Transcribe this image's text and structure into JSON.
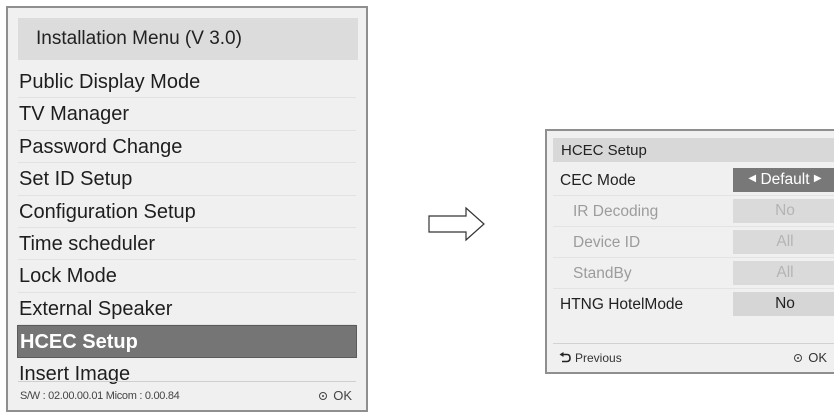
{
  "install_menu": {
    "title": "Installation Menu (V 3.0)",
    "items": [
      {
        "label": "Public Display Mode"
      },
      {
        "label": "TV Manager"
      },
      {
        "label": "Password Change"
      },
      {
        "label": "Set ID Setup"
      },
      {
        "label": "Configuration Setup"
      },
      {
        "label": "Time scheduler"
      },
      {
        "label": "Lock Mode"
      },
      {
        "label": "External Speaker"
      },
      {
        "label": "HCEC Setup",
        "selected": true
      },
      {
        "label": "Insert Image"
      }
    ],
    "footer": {
      "firmware": "S/W : 02.00.00.01  Micom : 0.00.84",
      "ok_label": "OK",
      "ok_icon": "ok-button-icon"
    }
  },
  "arrow": {
    "icon": "right-arrow-icon"
  },
  "hcec_setup": {
    "title": "HCEC Setup",
    "rows": [
      {
        "label": "CEC Mode",
        "value": "Default",
        "state": "active"
      },
      {
        "label": "IR Decoding",
        "value": "No",
        "state": "disabled"
      },
      {
        "label": "Device ID",
        "value": "All",
        "state": "disabled"
      },
      {
        "label": "StandBy",
        "value": "All",
        "state": "disabled"
      },
      {
        "label": "HTNG HotelMode",
        "value": "No",
        "state": "normal"
      }
    ],
    "footer": {
      "previous_label": "Previous",
      "previous_icon": "back-arrow-icon",
      "ok_label": "OK",
      "ok_icon": "ok-button-icon"
    }
  },
  "colors": {
    "selected_bg": "#757575",
    "active_value_bg": "#787878",
    "panel_bg": "#f0f0f0",
    "border": "#8f8f8f"
  }
}
